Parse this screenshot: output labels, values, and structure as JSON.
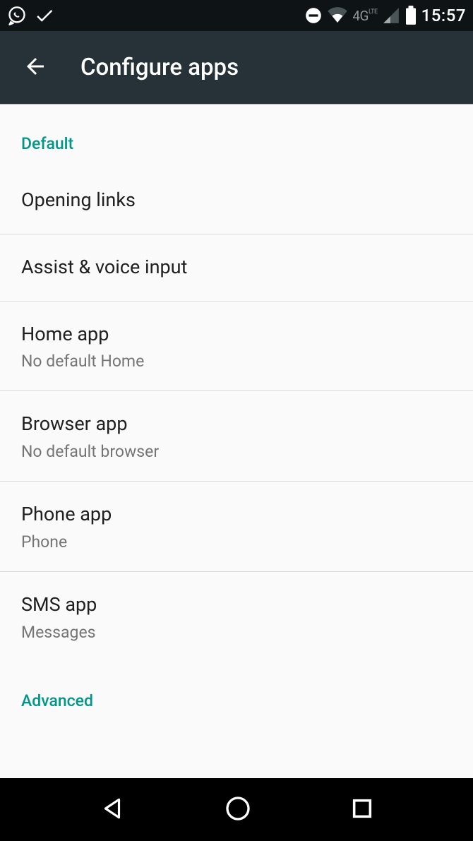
{
  "status": {
    "time": "15:57",
    "network_label": "4G",
    "network_sub": "LTE"
  },
  "header": {
    "title": "Configure apps"
  },
  "sections": {
    "default_label": "Default",
    "advanced_label": "Advanced"
  },
  "items": {
    "opening_links": {
      "title": "Opening links"
    },
    "assist": {
      "title": "Assist & voice input"
    },
    "home": {
      "title": "Home app",
      "sub": "No default Home"
    },
    "browser": {
      "title": "Browser app",
      "sub": "No default browser"
    },
    "phone": {
      "title": "Phone app",
      "sub": "Phone"
    },
    "sms": {
      "title": "SMS app",
      "sub": "Messages"
    }
  }
}
